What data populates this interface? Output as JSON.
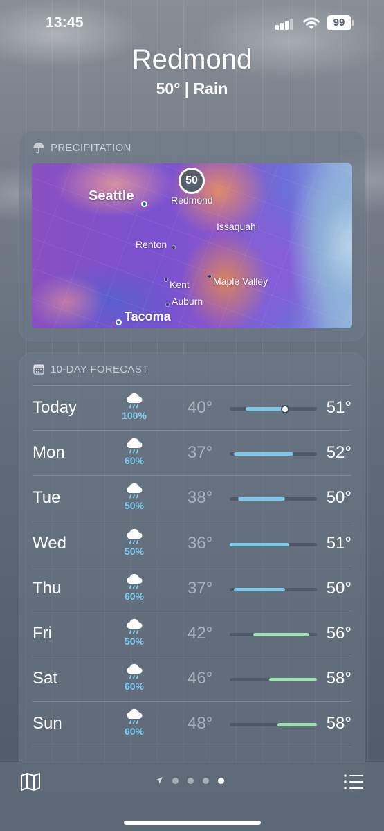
{
  "status_bar": {
    "time": "13:45",
    "battery": "99"
  },
  "header": {
    "city": "Redmond",
    "summary": "50° | Rain"
  },
  "precipitation": {
    "title": "PRECIPITATION",
    "icon": "umbrella-icon",
    "pin_temp": "50",
    "places": {
      "seattle": "Seattle",
      "redmond": "Redmond",
      "issaquah": "Issaquah",
      "renton": "Renton",
      "kent": "Kent",
      "maple_valley": "Maple Valley",
      "auburn": "Auburn",
      "tacoma": "Tacoma"
    }
  },
  "forecast": {
    "title": "10-DAY FORECAST",
    "icon": "calendar-icon",
    "scale_min": 36,
    "scale_max": 58,
    "current_temp": 50,
    "days": [
      {
        "day": "Today",
        "pct": "100%",
        "low": "40°",
        "high": "51°",
        "lo": 40,
        "hi": 51
      },
      {
        "day": "Mon",
        "pct": "60%",
        "low": "37°",
        "high": "52°",
        "lo": 37,
        "hi": 52
      },
      {
        "day": "Tue",
        "pct": "50%",
        "low": "38°",
        "high": "50°",
        "lo": 38,
        "hi": 50
      },
      {
        "day": "Wed",
        "pct": "50%",
        "low": "36°",
        "high": "51°",
        "lo": 36,
        "hi": 51
      },
      {
        "day": "Thu",
        "pct": "60%",
        "low": "37°",
        "high": "50°",
        "lo": 37,
        "hi": 50
      },
      {
        "day": "Fri",
        "pct": "50%",
        "low": "42°",
        "high": "56°",
        "lo": 42,
        "hi": 56
      },
      {
        "day": "Sat",
        "pct": "60%",
        "low": "46°",
        "high": "58°",
        "lo": 46,
        "hi": 58
      },
      {
        "day": "Sun",
        "pct": "60%",
        "low": "48°",
        "high": "58°",
        "lo": 48,
        "hi": 58
      }
    ]
  },
  "bottom_bar": {
    "page_count": 4,
    "active_page": 4
  },
  "colors": {
    "precip_pct": "#7fcff6",
    "bar_cool": "#7cc8e8",
    "bar_warm": "#9ee0b4"
  }
}
